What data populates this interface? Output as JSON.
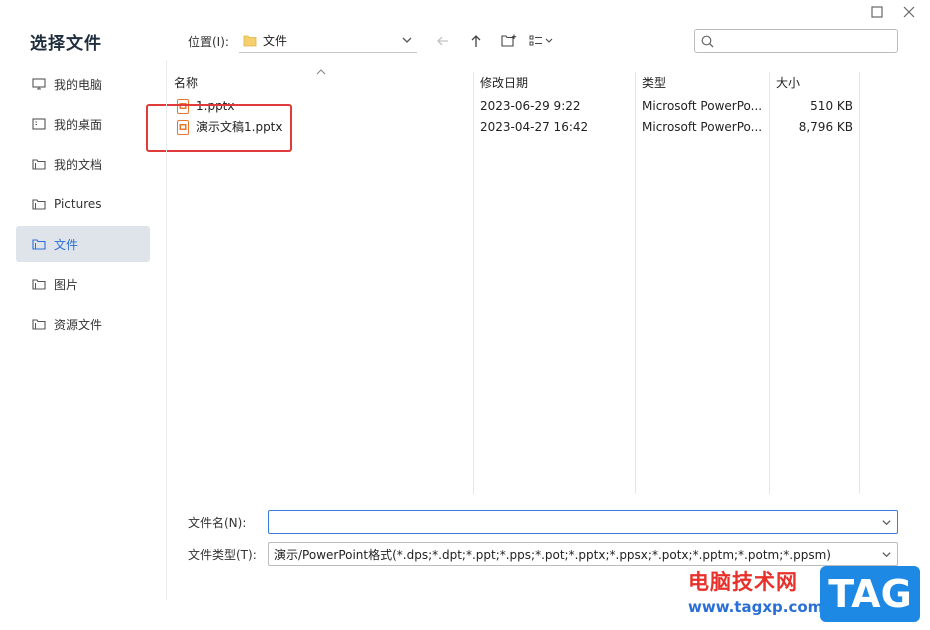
{
  "dialog": {
    "title": "选择文件"
  },
  "sidebar": {
    "items": [
      {
        "label": "我的电脑",
        "icon": "computer-icon",
        "active": false
      },
      {
        "label": "我的桌面",
        "icon": "desktop-icon",
        "active": false
      },
      {
        "label": "我的文档",
        "icon": "folder-icon",
        "active": false
      },
      {
        "label": "Pictures",
        "icon": "folder-icon",
        "active": false
      },
      {
        "label": "文件",
        "icon": "folder-icon",
        "active": true
      },
      {
        "label": "图片",
        "icon": "folder-icon",
        "active": false
      },
      {
        "label": "资源文件",
        "icon": "folder-icon",
        "active": false
      }
    ]
  },
  "toolbar": {
    "location_label": "位置(I):",
    "location_value": "文件"
  },
  "columns": {
    "name": "名称",
    "modified": "修改日期",
    "type": "类型",
    "size": "大小"
  },
  "files": [
    {
      "name": "1.pptx",
      "modified": "2023-06-29 9:22",
      "type": "Microsoft PowerPo...",
      "size": "510 KB"
    },
    {
      "name": "演示文稿1.pptx",
      "modified": "2023-04-27 16:42",
      "type": "Microsoft PowerPo...",
      "size": "8,796 KB"
    }
  ],
  "form": {
    "filename_label": "文件名(N):",
    "filename_value": "",
    "filetype_label": "文件类型(T):",
    "filetype_value": "演示/PowerPoint格式(*.dps;*.dpt;*.ppt;*.pps;*.pot;*.pptx;*.ppsx;*.potx;*.pptm;*.potm;*.ppsm)"
  },
  "watermark": {
    "site_name": "电脑技术网",
    "url": "www.tagxp.com",
    "tag": "TAG"
  },
  "colors": {
    "accent": "#2b6fd6",
    "highlight_box": "#e03a3a",
    "active_bg": "#dfe3ea",
    "pptx_icon": "#e8772e"
  }
}
